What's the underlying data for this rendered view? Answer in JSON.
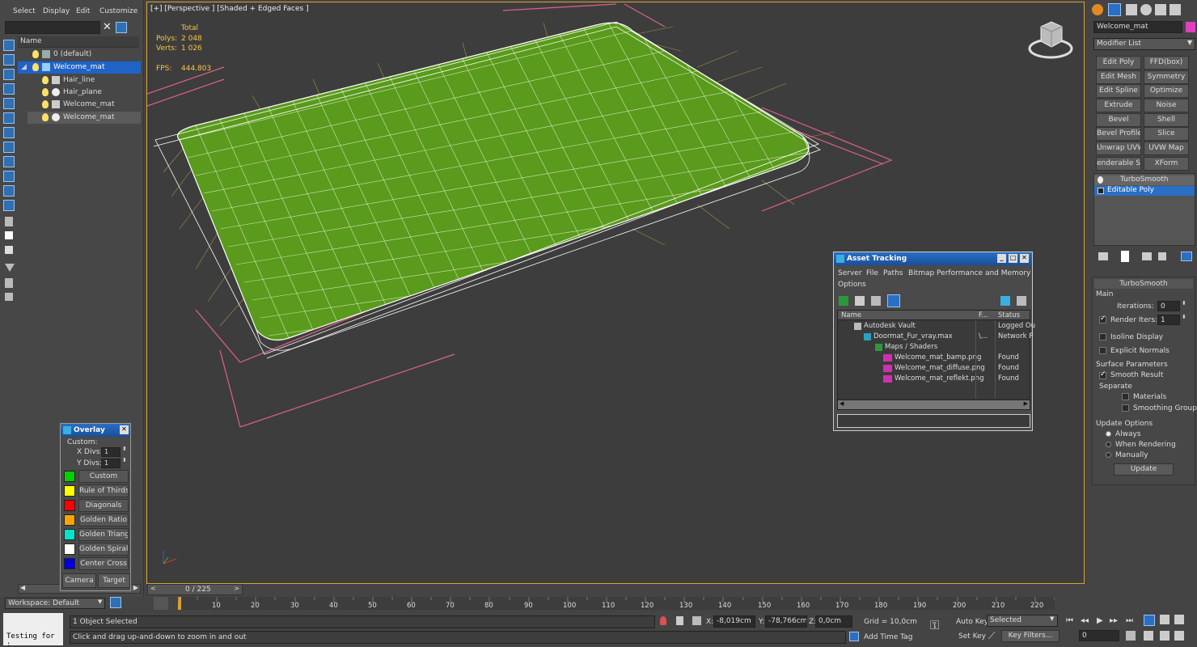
{
  "menu": [
    "Select",
    "Display",
    "Edit",
    "Customize"
  ],
  "explorer": {
    "search_value": "",
    "column_name": "Name",
    "items": [
      {
        "label": "0 (default)",
        "indent": 0
      },
      {
        "label": "Welcome_mat",
        "indent": 0
      },
      {
        "label": "Hair_line",
        "indent": 1
      },
      {
        "label": "Hair_plane",
        "indent": 1
      },
      {
        "label": "Welcome_mat",
        "indent": 1
      },
      {
        "label": "Welcome_mat",
        "indent": 1
      }
    ],
    "workspace": "Workspace: Default"
  },
  "viewport": {
    "label": "[+] [Perspective ] [Shaded + Edged Faces ]",
    "stats_total": "Total",
    "polys_label": "Polys:",
    "polys_value": "2 048",
    "verts_label": "Verts:",
    "verts_value": "1 026",
    "fps_label": "FPS:",
    "fps_value": "444.803",
    "accent": "#d9a32d",
    "mesh_color": "#5a9a1c"
  },
  "overlay": {
    "title": "Overlay",
    "custom_label": "Custom:",
    "xdivs_label": "X Divs:",
    "xdivs_value": "1",
    "ydivs_label": "Y Divs:",
    "ydivs_value": "1",
    "items": [
      {
        "label": "Custom",
        "color": "#00d200"
      },
      {
        "label": "Rule of Thirds",
        "color": "#ffff00"
      },
      {
        "label": "Diagonals",
        "color": "#ff0000"
      },
      {
        "label": "Golden Ratio",
        "color": "#ffa500"
      },
      {
        "label": "Golden Triangle",
        "color": "#00e6c8"
      },
      {
        "label": "Golden Spiral",
        "color": "#ffffff"
      },
      {
        "label": "Center Cross",
        "color": "#0000dd"
      }
    ],
    "camera_label": "Camera",
    "target_label": "Target"
  },
  "asset_tracking": {
    "title": "Asset Tracking",
    "menu": [
      "Server",
      "File",
      "Paths",
      "Bitmap Performance and Memory",
      "Options"
    ],
    "columns": [
      "Name",
      "F...",
      "Status"
    ],
    "rows": [
      {
        "name": "Autodesk Vault",
        "f": "",
        "status": "Logged Ou",
        "indent": 1
      },
      {
        "name": "Doormat_Fur_vray.max",
        "f": "\\...",
        "status": "Network P",
        "indent": 2
      },
      {
        "name": "Maps / Shaders",
        "f": "",
        "status": "",
        "indent": 3
      },
      {
        "name": "Welcome_mat_bamp.png",
        "f": "",
        "status": "Found",
        "indent": 4
      },
      {
        "name": "Welcome_mat_diffuse.png",
        "f": "",
        "status": "Found",
        "indent": 4
      },
      {
        "name": "Welcome_mat_reflekt.png",
        "f": "",
        "status": "Found",
        "indent": 4
      }
    ]
  },
  "command_panel": {
    "object_name": "Welcome_mat",
    "object_color": "#e040c0",
    "modifier_list": "Modifier List",
    "buttons": [
      [
        "Edit Poly",
        "FFD(box)"
      ],
      [
        "Edit Mesh",
        "Symmetry"
      ],
      [
        "Edit Spline",
        "Optimize"
      ],
      [
        "Extrude",
        "Noise"
      ],
      [
        "Bevel",
        "Shell"
      ],
      [
        "Bevel Profile",
        "Slice"
      ],
      [
        "Unwrap UVW",
        "UVW Map"
      ],
      [
        "enderable Splin",
        "XForm"
      ]
    ],
    "stack": [
      "TurboSmooth",
      "Editable Poly"
    ],
    "rollout_title": "TurboSmooth",
    "main_label": "Main",
    "iterations_label": "Iterations:",
    "iterations_value": "0",
    "render_iters_label": "Render Iters:",
    "render_iters_value": "1",
    "isoline_label": "Isoline Display",
    "explicit_normals_label": "Explicit Normals",
    "surface_params_label": "Surface Parameters",
    "smooth_result_label": "Smooth Result",
    "separate_label": "Separate",
    "materials_label": "Materials",
    "smoothing_groups_label": "Smoothing Groups",
    "update_options_label": "Update Options",
    "always_label": "Always",
    "when_rendering_label": "When Rendering",
    "manually_label": "Manually",
    "update_button": "Update"
  },
  "timeline": {
    "frame_display": "0 / 225",
    "ticks": [
      "10",
      "20",
      "30",
      "40",
      "50",
      "60",
      "70",
      "80",
      "90",
      "100",
      "110",
      "120",
      "130",
      "140",
      "150",
      "160",
      "170",
      "180",
      "190",
      "200",
      "210",
      "220"
    ]
  },
  "status": {
    "script_text": "Testing for :",
    "selection": "1 Object Selected",
    "prompt": "Click and drag up-and-down to zoom in and out",
    "x_label": "X:",
    "x_value": "-8,019cm",
    "y_label": "Y:",
    "y_value": "-78,766cm",
    "z_label": "Z:",
    "z_value": "0,0cm",
    "grid": "Grid = 10,0cm",
    "add_time_tag": "Add Time Tag",
    "auto_key": "Auto Key",
    "set_key": "Set Key",
    "selected": "Selected",
    "key_filters": "Key Filters...",
    "frame_value": "0"
  }
}
